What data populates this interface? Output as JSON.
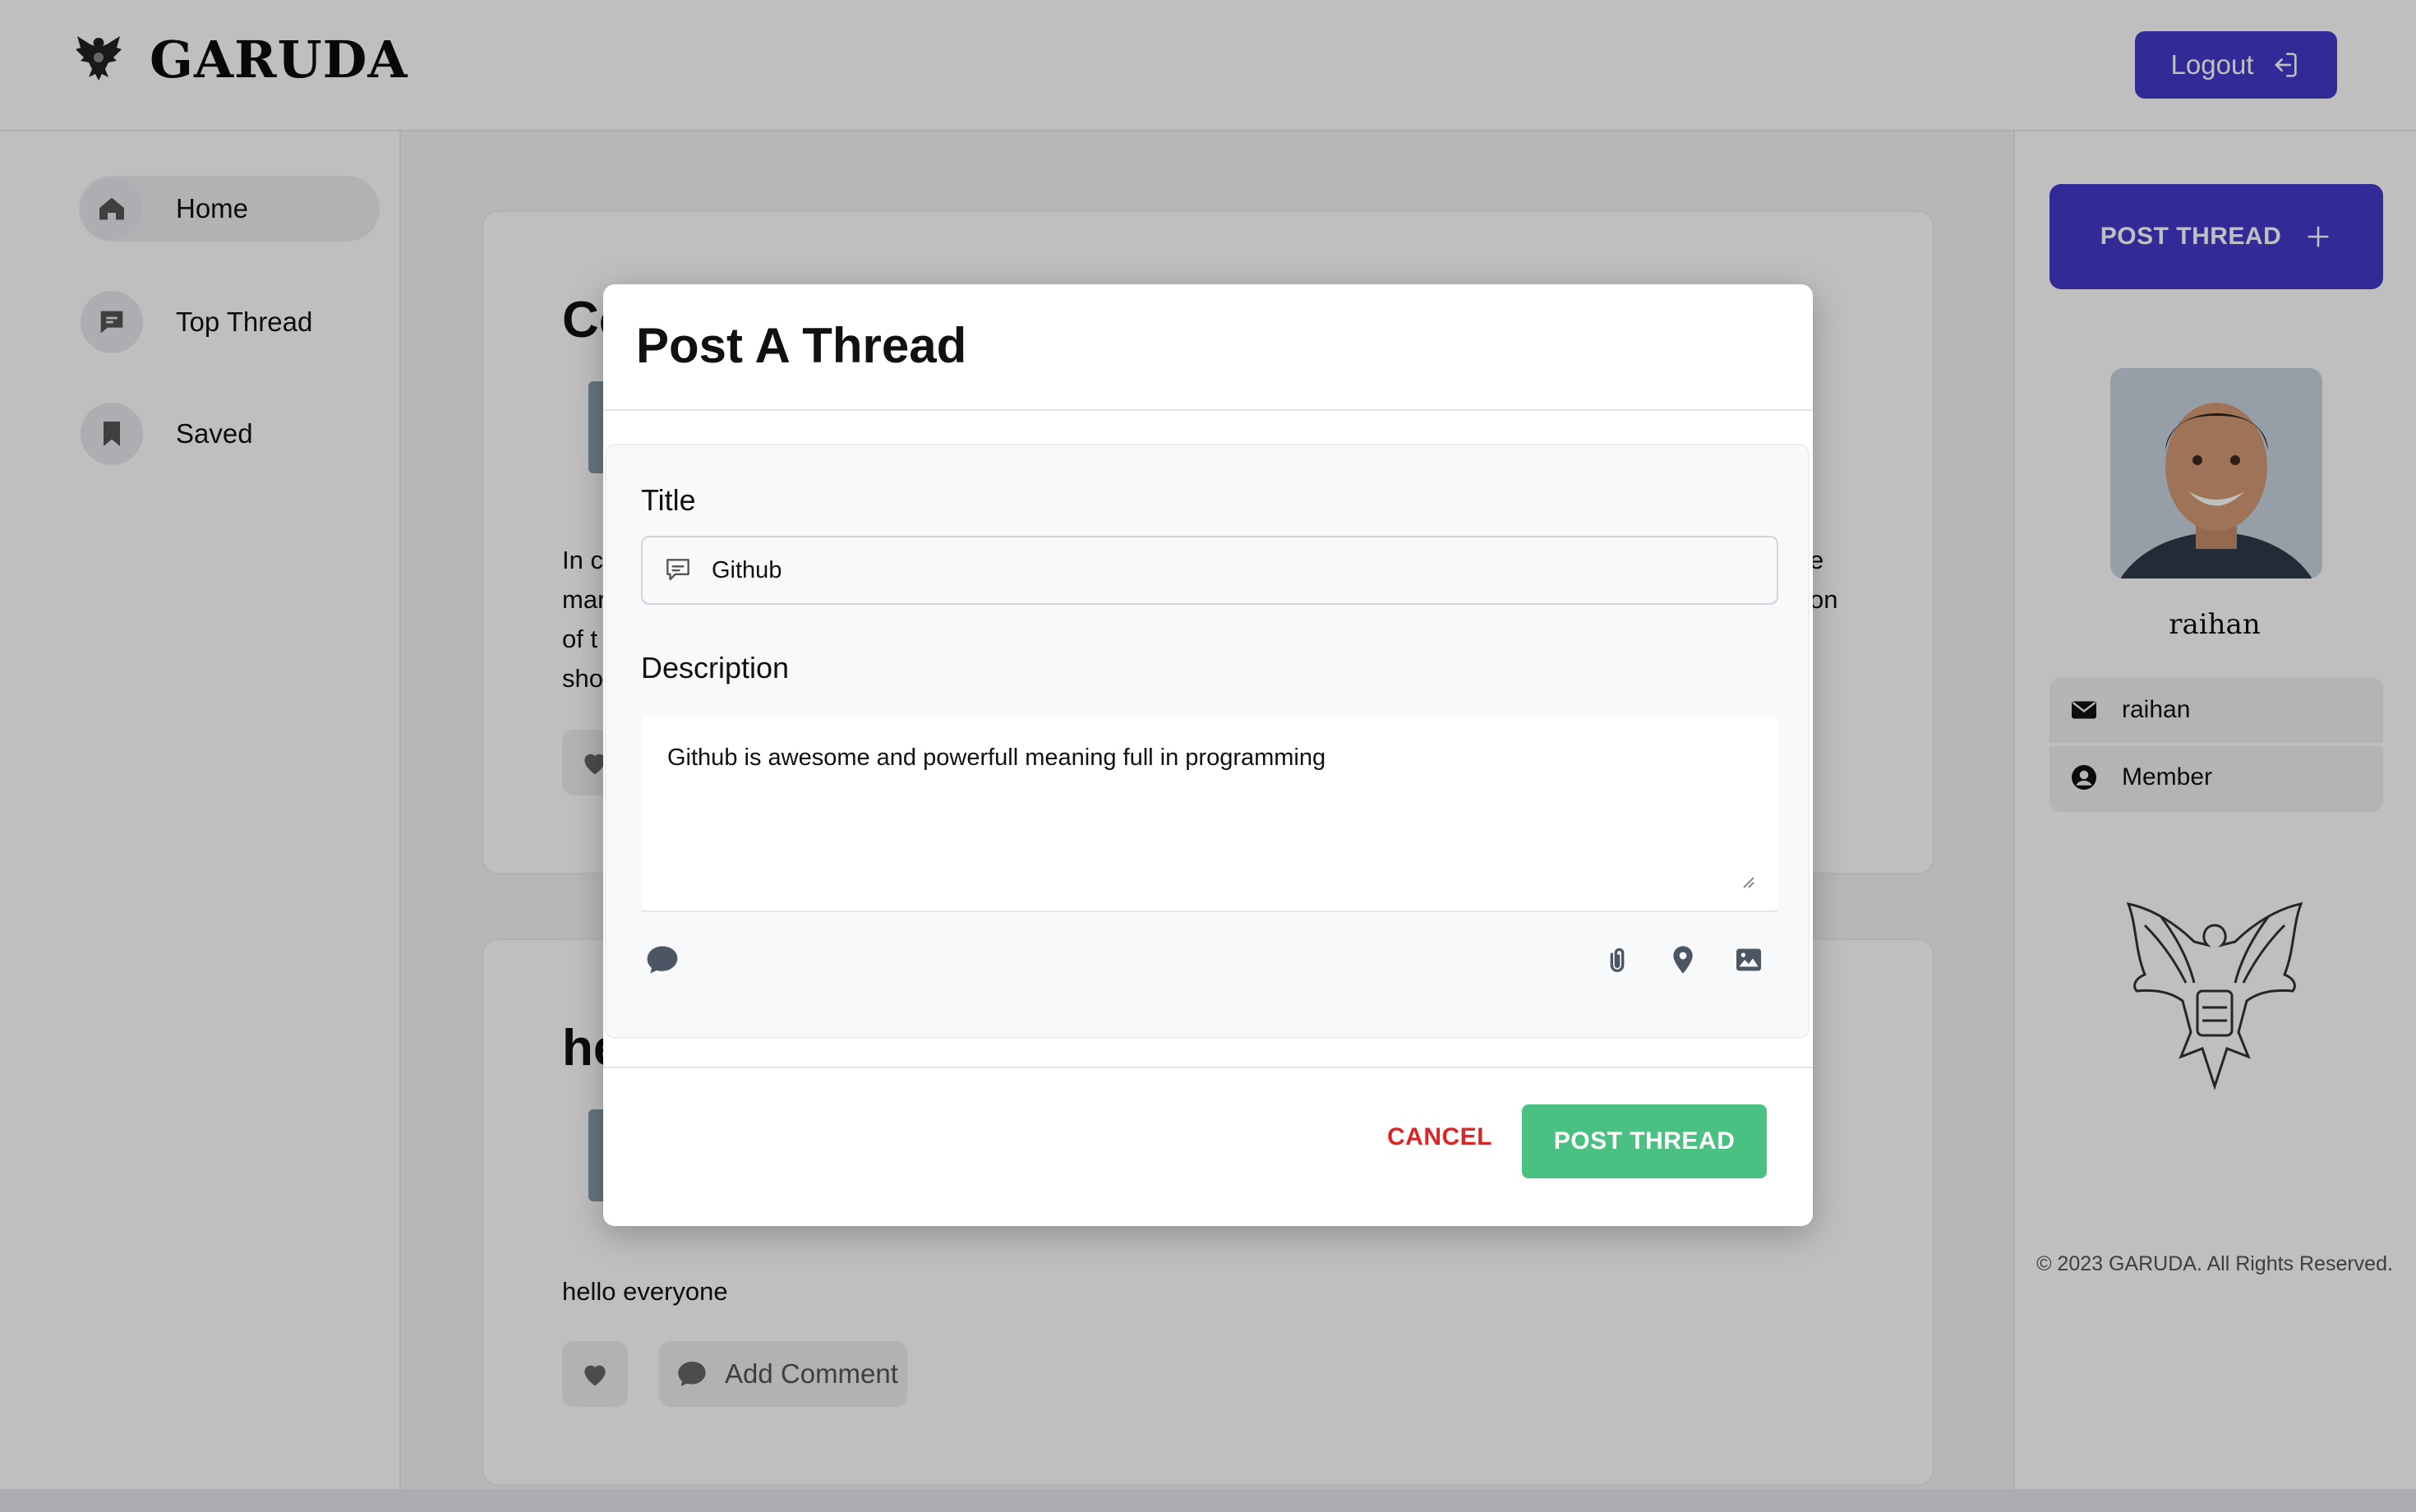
{
  "app": {
    "brand_name": "GARUDA",
    "logout_label": "Logout"
  },
  "sidebar": {
    "items": [
      {
        "label": "Home",
        "icon": "home-icon",
        "active": true
      },
      {
        "label": "Top Thread",
        "icon": "chat-icon",
        "active": false
      },
      {
        "label": "Saved",
        "icon": "bookmark-icon",
        "active": false
      }
    ]
  },
  "feed": {
    "cards": [
      {
        "title_visible": "Co",
        "text_lines": [
          "In co",
          "mar",
          "of t",
          "sho"
        ],
        "text_right_fragments": [
          "e",
          "on"
        ]
      },
      {
        "title_visible": "he",
        "body": "hello everyone",
        "comment_label": "Add Comment"
      }
    ]
  },
  "rightbar": {
    "post_button_label": "POST THREAD",
    "profile_name": "raihan",
    "email": "raihan",
    "role": "Member",
    "copyright": "© 2023 GARUDA. All Rights Reserved."
  },
  "modal": {
    "heading": "Post A Thread",
    "title_label": "Title",
    "title_value": "Github",
    "description_label": "Description",
    "description_value": "Github is awesome and powerfull meaning full in programming",
    "cancel_label": "CANCEL",
    "submit_label": "POST THREAD"
  },
  "colors": {
    "primary": "#4338ca",
    "success": "#4ac083",
    "danger": "#dc2626",
    "overlay": "rgba(0,0,0,0.25)"
  }
}
